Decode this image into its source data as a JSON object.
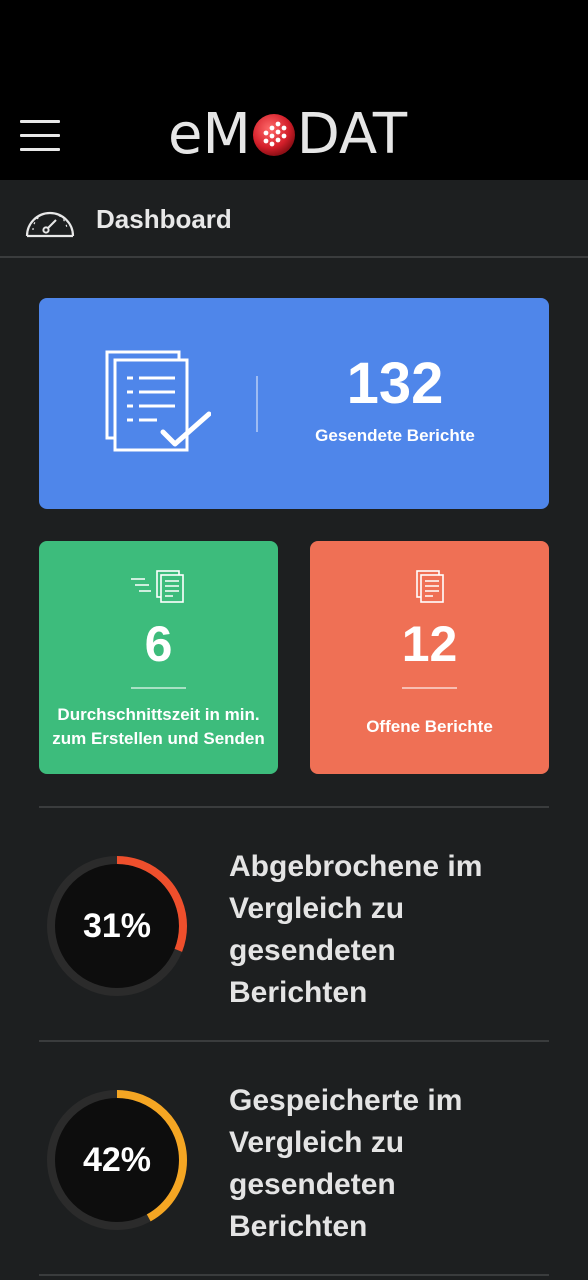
{
  "app": {
    "logo_left": "eM",
    "logo_right": "DAT"
  },
  "breadcrumb": {
    "title": "Dashboard",
    "icon": "gauge-icon"
  },
  "cards": {
    "sent": {
      "value": "132",
      "label": "Gesendete Berichte",
      "icon": "document-check-icon",
      "color": "#4f86ea"
    },
    "avg_time": {
      "value": "6",
      "label_line1": "Durchschnittszeit in min.",
      "label_line2": "zum Erstellen und Senden",
      "icon": "fast-document-icon",
      "color": "#3dbc7c"
    },
    "open": {
      "value": "12",
      "label": "Offene Berichte",
      "icon": "document-icon",
      "color": "#ef7055"
    }
  },
  "stats": [
    {
      "percent": 31,
      "label": "31%",
      "line1": "Abgebrochene im",
      "line2": "Vergleich zu",
      "line3": "gesendeten",
      "line4": "Berichten",
      "color": "#ee4f2c"
    },
    {
      "percent": 42,
      "label": "42%",
      "line1": "Gespeicherte im",
      "line2": "Vergleich zu",
      "line3": "gesendeten",
      "line4": "Berichten",
      "color": "#f5a623"
    }
  ]
}
